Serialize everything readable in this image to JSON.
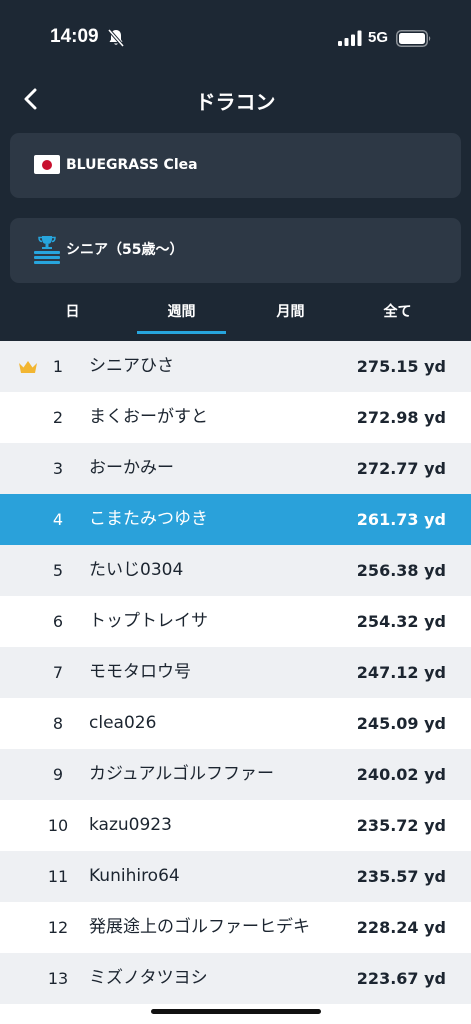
{
  "status_bar": {
    "time": "14:09",
    "network": "5G",
    "icons": [
      "bell-muted-icon",
      "signal-icon",
      "battery-icon"
    ]
  },
  "nav": {
    "title": "ドラコン",
    "back_icon": "chevron-left-icon"
  },
  "course_selector": {
    "label": "BLUEGRASS Clea",
    "icon": "japan-flag-icon"
  },
  "category_selector": {
    "label": "シニア（55歳〜）",
    "icon": "podium-icon"
  },
  "tabs": [
    {
      "label": "日",
      "active": false
    },
    {
      "label": "週間",
      "active": true
    },
    {
      "label": "月間",
      "active": false
    },
    {
      "label": "全て",
      "active": false
    }
  ],
  "rankings": [
    {
      "rank": "1",
      "name": "シニアひさ",
      "distance": "275.15 yd",
      "crown": true
    },
    {
      "rank": "2",
      "name": "まくおーがすと",
      "distance": "272.98 yd"
    },
    {
      "rank": "3",
      "name": "おーかみー",
      "distance": "272.77 yd"
    },
    {
      "rank": "4",
      "name": "こまたみつゆき",
      "distance": "261.73 yd",
      "highlight": true
    },
    {
      "rank": "5",
      "name": "たいじ0304",
      "distance": "256.38 yd"
    },
    {
      "rank": "6",
      "name": "トップトレイサ",
      "distance": "254.32 yd"
    },
    {
      "rank": "7",
      "name": "モモタロウ号",
      "distance": "247.12 yd"
    },
    {
      "rank": "8",
      "name": "clea026",
      "distance": "245.09 yd"
    },
    {
      "rank": "9",
      "name": "カジュアルゴルフファー",
      "distance": "240.02 yd"
    },
    {
      "rank": "10",
      "name": "kazu0923",
      "distance": "235.72 yd"
    },
    {
      "rank": "11",
      "name": "Kunihiro64",
      "distance": "235.57 yd"
    },
    {
      "rank": "12",
      "name": "発展途上のゴルファーヒデキ",
      "distance": "228.24 yd"
    },
    {
      "rank": "13",
      "name": "ミズノタツヨシ",
      "distance": "223.67 yd"
    }
  ],
  "colors": {
    "header_bg": "#1d2834",
    "card_bg": "#2d3845",
    "accent": "#2aa1da",
    "crown": "#f2b632"
  }
}
